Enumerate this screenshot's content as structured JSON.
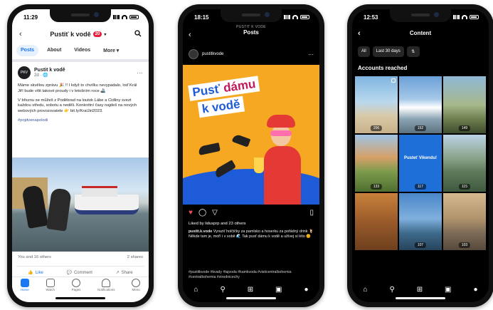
{
  "facebook": {
    "status_time": "11:29",
    "page_title": "Pustiť k vodě",
    "notification_count": "20",
    "tabs": [
      "Posts",
      "About",
      "Videos",
      "More ▾"
    ],
    "post": {
      "author": "Pustit k vodě",
      "meta": "2d · 🌐",
      "paragraph1": "Máme skvělou zprávu 🎉 !! I když to chvílku nevypadalo, loď Král Jiří bude vítit takové proudy i v letošním roce 🚢",
      "paragraph2": "V březnu se můžeš z Poděbrad na loutok Lábe a Cidliny svezt každou středu, sobotu a neděli. Konkrétní časy najdeš na nových webových provozovatele 👉 bit.ly/KralJiri2023.",
      "hashtag": "#pojdvenapolodi"
    },
    "reactions": "You and 16 others",
    "shares": "2 shares",
    "actions": [
      "Like",
      "Comment",
      "Share"
    ],
    "nav": [
      "Home",
      "Watch",
      "Pages",
      "Notifications",
      "Menu"
    ]
  },
  "instagram_post": {
    "status_time": "18:15",
    "header_small": "PUSTIT K VODE",
    "header_title": "Posts",
    "username": "pustitkvode",
    "headline_line1_a": "Pusť ",
    "headline_line1_b": "dámu",
    "headline_line2": "k vodě",
    "likes": "Liked by lidusprp and 23 others",
    "caption_user": "pustit.k.vode",
    "caption": "Vyraziť holčičky za pamlsko a hoserku za pořádný drink 🍹 Někde tam je, moří i v sobě 🌊 Tak pusť dámu k vodě a užívej si léto 🌞",
    "tags": "#pustitkvode #kvady #lajvoda #kamkvoda #visitcentralbohemia #centralbohemia #strednicechy"
  },
  "instagram_content": {
    "status_time": "12:53",
    "title": "Content",
    "filters": [
      "All",
      "Last 30 days"
    ],
    "section": "Accounts reached",
    "tile_counts": [
      "206",
      "152",
      "149",
      "133",
      "117",
      "115",
      "",
      "107",
      "103"
    ],
    "tile_blue_text": "Pusteť Vikendu!"
  }
}
